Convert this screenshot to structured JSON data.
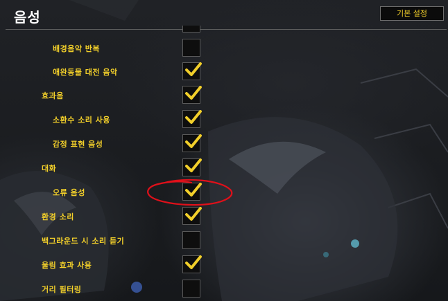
{
  "header": {
    "title": "음성",
    "defaults_button_label": "기본 설정"
  },
  "options": [
    {
      "label": "배경음악 반복",
      "checked": false
    },
    {
      "label": "애완동물 대전 음악",
      "checked": true
    },
    {
      "label": "효과음",
      "checked": true
    },
    {
      "label": "소환수 소리 사용",
      "checked": true
    },
    {
      "label": "감정 표현 음성",
      "checked": true
    },
    {
      "label": "대화",
      "checked": true
    },
    {
      "label": "오류 음성",
      "checked": true
    },
    {
      "label": "환경 소리",
      "checked": true
    },
    {
      "label": "백그라운드 시 소리 듣기",
      "checked": false
    },
    {
      "label": "울림 효과 사용",
      "checked": true
    },
    {
      "label": "거리 필터링",
      "checked": false
    }
  ],
  "colors": {
    "label": "#f2cf2a",
    "checkmark": "#f2cf2a",
    "annotation": "#e0101a"
  },
  "annotation": {
    "shape": "hand-drawn red ellipse",
    "target": "오류 음성 checkbox"
  }
}
